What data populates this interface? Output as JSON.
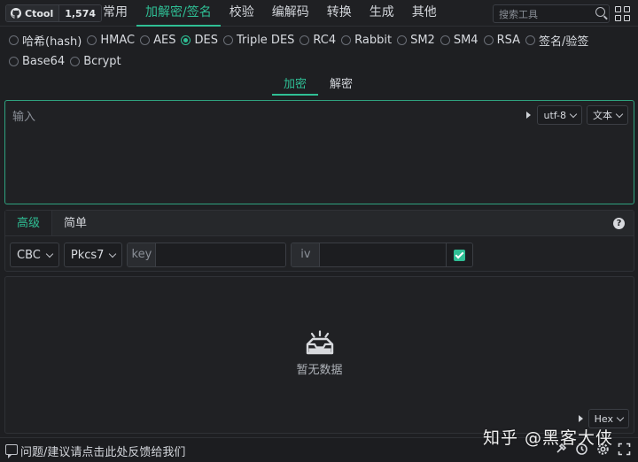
{
  "github": {
    "label": "Ctool",
    "stars": "1,574"
  },
  "nav": [
    "常用",
    "加解密/签名",
    "校验",
    "编解码",
    "转换",
    "生成",
    "其他"
  ],
  "nav_active": 1,
  "search": {
    "placeholder": "搜索工具"
  },
  "algorithms": [
    {
      "label": "哈希(hash)",
      "selected": false
    },
    {
      "label": "HMAC",
      "selected": false
    },
    {
      "label": "AES",
      "selected": false
    },
    {
      "label": "DES",
      "selected": true
    },
    {
      "label": "Triple DES",
      "selected": false
    },
    {
      "label": "RC4",
      "selected": false
    },
    {
      "label": "Rabbit",
      "selected": false
    },
    {
      "label": "SM2",
      "selected": false
    },
    {
      "label": "SM4",
      "selected": false
    },
    {
      "label": "RSA",
      "selected": false
    },
    {
      "label": "签名/验签",
      "selected": false
    },
    {
      "label": "Base64",
      "selected": false
    },
    {
      "label": "Bcrypt",
      "selected": false
    }
  ],
  "mode_tabs": {
    "encrypt": "加密",
    "decrypt": "解密"
  },
  "input": {
    "placeholder": "输入",
    "encoding": "utf-8",
    "type": "文本"
  },
  "options": {
    "tab_advanced": "高级",
    "tab_simple": "简单",
    "help": "?",
    "mode": "CBC",
    "padding": "Pkcs7",
    "key_label": "key",
    "iv_label": "iv",
    "iv_enabled": true
  },
  "output": {
    "empty_text": "暂无数据",
    "format": "Hex"
  },
  "footer": {
    "feedback": "问题/建议请点击此处反馈给我们"
  },
  "watermark": "知乎 @黑客大侠",
  "colors": {
    "accent": "#2fbf95",
    "background": "#1e1f22",
    "panel": "#202124"
  }
}
